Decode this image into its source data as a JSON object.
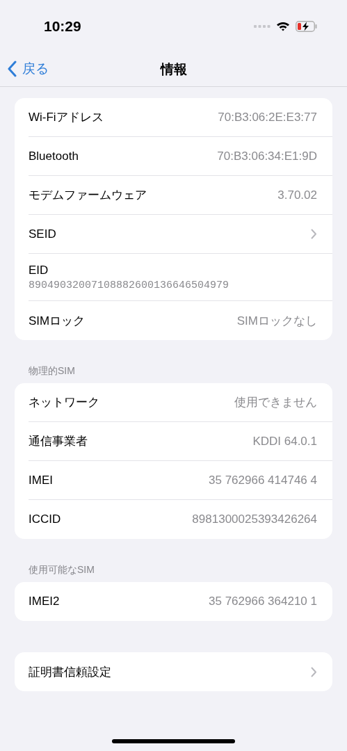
{
  "status_bar": {
    "time": "10:29"
  },
  "nav": {
    "back": "戻る",
    "title": "情報"
  },
  "groups": [
    {
      "rows": [
        {
          "kind": "value",
          "label": "Wi-Fiアドレス",
          "value": "70:B3:06:2E:E3:77"
        },
        {
          "kind": "value",
          "label": "Bluetooth",
          "value": "70:B3:06:34:E1:9D"
        },
        {
          "kind": "value",
          "label": "モデムファームウェア",
          "value": "3.70.02"
        },
        {
          "kind": "chevron",
          "label": "SEID"
        },
        {
          "kind": "subtitle",
          "label": "EID",
          "value": "89049032007108882600136646504979"
        },
        {
          "kind": "value",
          "label": "SIMロック",
          "value": "SIMロックなし"
        }
      ]
    },
    {
      "header": "物理的SIM",
      "rows": [
        {
          "kind": "value",
          "label": "ネットワーク",
          "value": "使用できません"
        },
        {
          "kind": "value",
          "label": "通信事業者",
          "value": "KDDI 64.0.1"
        },
        {
          "kind": "value",
          "label": "IMEI",
          "value": "35 762966 414746 4"
        },
        {
          "kind": "value",
          "label": "ICCID",
          "value": "8981300025393426264"
        }
      ]
    },
    {
      "header": "使用可能なSIM",
      "rows": [
        {
          "kind": "value",
          "label": "IMEI2",
          "value": "35 762966 364210 1"
        }
      ]
    },
    {
      "rows": [
        {
          "kind": "chevron",
          "label": "証明書信頼設定"
        }
      ]
    }
  ]
}
